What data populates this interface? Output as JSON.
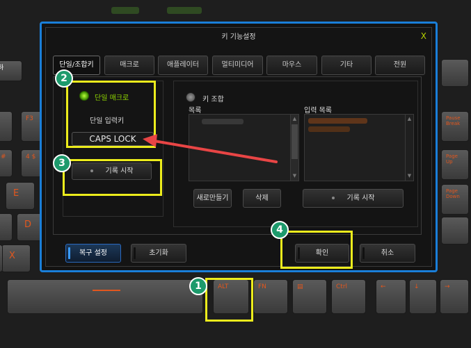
{
  "dialog": {
    "title": "키 기능설정",
    "close_label": "X"
  },
  "tabs": [
    {
      "label": "단일/조합키"
    },
    {
      "label": "매크로"
    },
    {
      "label": "애플레이터"
    },
    {
      "label": "멀티미디어"
    },
    {
      "label": "마우스"
    },
    {
      "label": "기타"
    },
    {
      "label": "전원"
    }
  ],
  "single": {
    "macro_label": "단일 매크로",
    "input_label": "단일 입력키",
    "input_value": "CAPS LOCK",
    "record_label": "기록 시작"
  },
  "combo": {
    "label": "키 조합",
    "list_label": "목록",
    "input_list_label": "입력 목록",
    "new_label": "새로만들기",
    "delete_label": "삭제",
    "record_label": "기록 시작"
  },
  "footer": {
    "restore_label": "복구 설정",
    "reset_label": "초기화",
    "ok_label": "확인",
    "cancel_label": "취소"
  },
  "keyboard": {
    "f3": "F3",
    "e": "E",
    "d": "D",
    "x": "X",
    "four": "4 $",
    "hash": "#",
    "pause": "Pause\nBreak",
    "pageup": "Page\nUp",
    "pagedown": "Page\nDown",
    "alt": "ALT",
    "fn": "FN",
    "ctrl": "Ctrl",
    "left": "←",
    "down": "↓",
    "right": "→"
  },
  "badges": [
    "1",
    "2",
    "3",
    "4"
  ],
  "colors": {
    "accent": "#1a7fd9",
    "highlight": "#ecec1c",
    "badge": "#1d9a6c",
    "key_text": "#e2571e",
    "arrow": "#e84545"
  }
}
